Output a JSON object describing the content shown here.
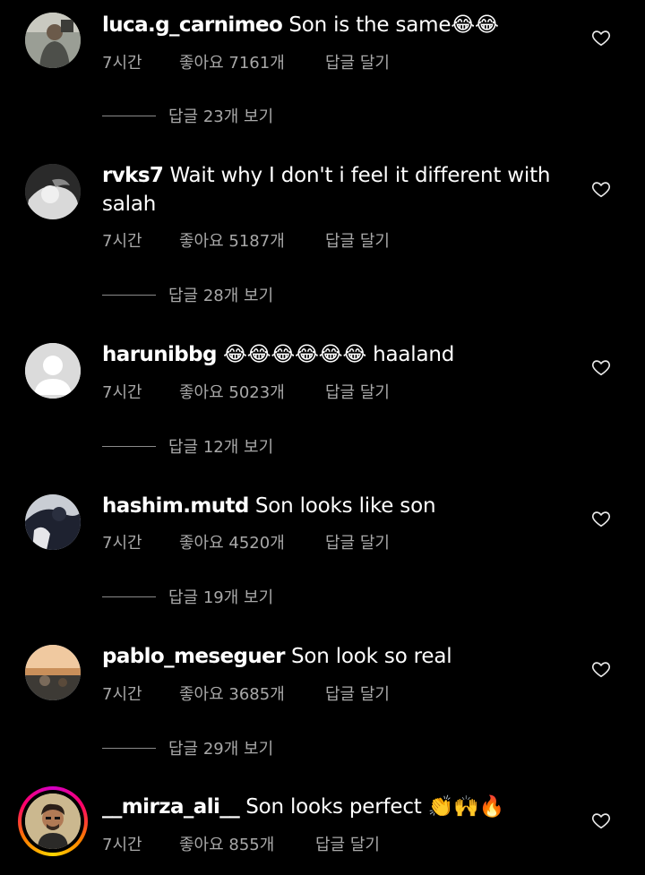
{
  "comments": [
    {
      "username": "luca.g_carnimeo",
      "text": " Son is the same😂😂",
      "time": "7시간",
      "likes": "좋아요 7161개",
      "reply": "답글 달기",
      "view_replies": "답글 23개 보기",
      "avatar_icon": "person-photo-avatar"
    },
    {
      "username": "rvks7",
      "text": " Wait why I don't i feel it different with salah",
      "time": "7시간",
      "likes": "좋아요 5187개",
      "reply": "답글 달기",
      "view_replies": "답글 28개 보기",
      "avatar_icon": "bw-photo-avatar"
    },
    {
      "username": "harunibbg",
      "text": " 😂😂😂😂😂😂 haaland",
      "time": "7시간",
      "likes": "좋아요 5023개",
      "reply": "답글 달기",
      "view_replies": "답글 12개 보기",
      "avatar_icon": "default-user-avatar"
    },
    {
      "username": "hashim.mutd",
      "text": " Son looks like son",
      "time": "7시간",
      "likes": "좋아요 4520개",
      "reply": "답글 달기",
      "view_replies": "답글 19개 보기",
      "avatar_icon": "dark-photo-avatar"
    },
    {
      "username": "pablo_meseguer",
      "text": " Son look so real",
      "time": "7시간",
      "likes": "좋아요 3685개",
      "reply": "답글 달기",
      "view_replies": "답글 29개 보기",
      "avatar_icon": "sunset-photo-avatar"
    },
    {
      "username": "__mirza_ali__",
      "text": " Son looks perfect 👏🙌🔥",
      "time": "7시간",
      "likes": "좋아요 855개",
      "reply": "답글 달기",
      "avatar_icon": "story-ring-avatar"
    }
  ],
  "colors": {
    "background": "#000000",
    "text": "#ffffff",
    "secondary": "#a8a8a8"
  }
}
